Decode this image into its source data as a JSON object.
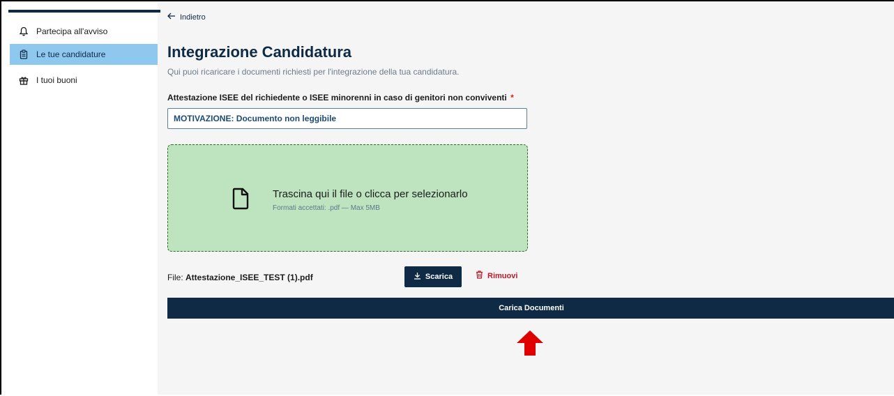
{
  "sidebar": {
    "items": [
      {
        "label": "Partecipa all'avviso",
        "icon": "bell-icon",
        "active": false
      },
      {
        "label": "Le tue candidature",
        "icon": "clipboard-icon",
        "active": true
      },
      {
        "label": "I tuoi buoni",
        "icon": "gift-icon",
        "active": false
      }
    ]
  },
  "header": {
    "back_label": "Indietro",
    "title": "Integrazione Candidatura",
    "subtitle": "Qui puoi ricaricare i documenti richiesti per l'integrazione della tua candidatura."
  },
  "form": {
    "field_label": "Attestazione ISEE del richiedente o ISEE minorenni in caso di genitori non conviventi",
    "required_mark": "*",
    "motivazione": "MOTIVAZIONE: Documento non leggibile",
    "dropzone": {
      "title": "Trascina qui il file o clicca per selezionarlo",
      "hint": "Formati accettati: .pdf — Max 5MB"
    },
    "file": {
      "prefix": "File: ",
      "name": "Attestazione_ISEE_TEST (1).pdf"
    },
    "download_label": "Scarica",
    "remove_label": "Rimuovi",
    "submit_label": "Carica Documenti"
  },
  "colors": {
    "primary": "#0e2a44",
    "active_sidebar": "#8fc8ef",
    "dropzone_bg": "#bde4be",
    "danger": "#c0182a",
    "annotation_arrow": "#e00000"
  }
}
